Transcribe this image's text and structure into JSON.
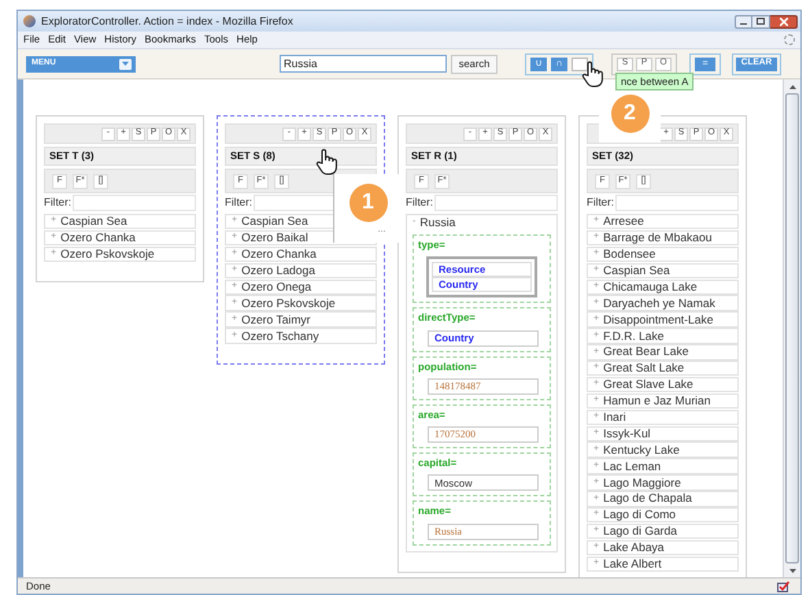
{
  "window": {
    "title": "ExploratorController. Action = index - Mozilla Firefox"
  },
  "menu_bar": [
    "File",
    "Edit",
    "View",
    "History",
    "Bookmarks",
    "Tools",
    "Help"
  ],
  "toolbar": {
    "menu_dropdown": "MENU",
    "search_field": {
      "value": "Russia"
    },
    "search_button": "search",
    "set_buttons": [
      {
        "label": "∪"
      },
      {
        "label": "∩"
      },
      {
        "kind": "blank"
      }
    ],
    "spo_buttons": [
      "S",
      "P",
      "O"
    ],
    "equals_button": "=",
    "clear_button": "CLEAR",
    "tooltip": "nce between A"
  },
  "sets": [
    {
      "title": "SET T (3)",
      "selected": false,
      "actions": [
        "-",
        "+",
        "S",
        "P",
        "O",
        "X"
      ],
      "tools": [
        "F",
        "F*",
        "[]"
      ],
      "filter_label": "Filter:",
      "items": [
        {
          "toggle": "+",
          "label": "Caspian Sea"
        },
        {
          "toggle": "+",
          "label": "Ozero Chanka"
        },
        {
          "toggle": "+",
          "label": "Ozero Pskovskoje"
        }
      ]
    },
    {
      "title": "SET S (8)",
      "selected": true,
      "actions": [
        "-",
        "+",
        "S",
        "P",
        "O",
        "X"
      ],
      "tools": [
        "F",
        "F*",
        "[]"
      ],
      "filter_label": "Filter:",
      "items": [
        {
          "toggle": "+",
          "label": "Caspian Sea"
        },
        {
          "toggle": "+",
          "label": "Ozero Baikal"
        },
        {
          "toggle": "+",
          "label": "Ozero Chanka"
        },
        {
          "toggle": "+",
          "label": "Ozero Ladoga"
        },
        {
          "toggle": "+",
          "label": "Ozero Onega"
        },
        {
          "toggle": "+",
          "label": "Ozero Pskovskoje"
        },
        {
          "toggle": "+",
          "label": "Ozero Taimyr"
        },
        {
          "toggle": "+",
          "label": "Ozero Tschany"
        }
      ]
    },
    {
      "title": "SET R (1)",
      "selected": false,
      "actions": [
        "-",
        "+",
        "S",
        "P",
        "O",
        "X"
      ],
      "tools": [
        "F",
        "F*"
      ],
      "filter_label": "Filter:",
      "items": [
        {
          "toggle": "-",
          "label": "Russia",
          "expanded": true,
          "properties": [
            {
              "name": "type=",
              "kind": "list",
              "values": [
                {
                  "kind": "resource",
                  "text": "Resource"
                },
                {
                  "kind": "resource",
                  "text": "Country"
                }
              ]
            },
            {
              "name": "directType=",
              "kind": "single",
              "values": [
                {
                  "kind": "resource",
                  "text": "Country"
                }
              ]
            },
            {
              "name": "population=",
              "kind": "single",
              "values": [
                {
                  "kind": "literal",
                  "text": "148178487"
                }
              ]
            },
            {
              "name": "area=",
              "kind": "single",
              "values": [
                {
                  "kind": "literal",
                  "text": "17075200"
                }
              ]
            },
            {
              "name": "capital=",
              "kind": "single",
              "values": [
                {
                  "kind": "text",
                  "text": "Moscow"
                }
              ]
            },
            {
              "name": "name=",
              "kind": "single",
              "values": [
                {
                  "kind": "literal",
                  "text": "Russia"
                }
              ]
            }
          ]
        }
      ]
    },
    {
      "title": "SET (32)",
      "selected": false,
      "actions": [
        "+",
        "S",
        "P",
        "O",
        "X"
      ],
      "tools": [
        "F",
        "F*",
        "[]"
      ],
      "filter_label": "Filter:",
      "items": [
        {
          "toggle": "+",
          "label": "Arresee"
        },
        {
          "toggle": "+",
          "label": "Barrage de Mbakaou"
        },
        {
          "toggle": "+",
          "label": "Bodensee"
        },
        {
          "toggle": "+",
          "label": "Caspian Sea"
        },
        {
          "toggle": "+",
          "label": "Chicamauga Lake"
        },
        {
          "toggle": "+",
          "label": "Daryacheh ye Namak"
        },
        {
          "toggle": "+",
          "label": "Disappointment-Lake"
        },
        {
          "toggle": "+",
          "label": "F.D.R. Lake"
        },
        {
          "toggle": "+",
          "label": "Great Bear Lake"
        },
        {
          "toggle": "+",
          "label": "Great Salt Lake"
        },
        {
          "toggle": "+",
          "label": "Great Slave Lake"
        },
        {
          "toggle": "+",
          "label": "Hamun e Jaz Murian"
        },
        {
          "toggle": "+",
          "label": "Inari"
        },
        {
          "toggle": "+",
          "label": "Issyk-Kul"
        },
        {
          "toggle": "+",
          "label": "Kentucky Lake"
        },
        {
          "toggle": "+",
          "label": "Lac Leman"
        },
        {
          "toggle": "+",
          "label": "Lago Maggiore"
        },
        {
          "toggle": "+",
          "label": "Lago de Chapala"
        },
        {
          "toggle": "+",
          "label": "Lago di Como"
        },
        {
          "toggle": "+",
          "label": "Lago di Garda"
        },
        {
          "toggle": "+",
          "label": "Lake Abaya"
        },
        {
          "toggle": "+",
          "label": "Lake Albert"
        }
      ]
    }
  ],
  "callouts": [
    {
      "number": "1",
      "caption": "..."
    },
    {
      "number": "2"
    }
  ],
  "status_bar": {
    "text": "Done"
  }
}
